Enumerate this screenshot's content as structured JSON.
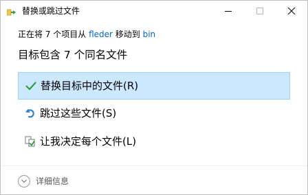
{
  "window": {
    "title": "替换或跳过文件",
    "controls": {
      "minimize": "minimize-icon",
      "maximize": "maximize-icon",
      "close": "close-icon"
    }
  },
  "move_info": {
    "prefix": "正在将 7 个项目从 ",
    "source": "fleder",
    "middle": " 移动到 ",
    "destination": "bin"
  },
  "heading": "目标包含 7 个同名文件",
  "options": {
    "replace": {
      "label": "替换目标中的文件(R)",
      "icon": "checkmark-icon",
      "selected": true
    },
    "skip": {
      "label": "跳过这些文件(S)",
      "icon": "skip-arrow-icon"
    },
    "decide": {
      "label": "让我决定每个文件(L)",
      "icon": "compare-files-icon"
    }
  },
  "details": {
    "label": "详细信息",
    "icon": "chevron-down-icon"
  },
  "colors": {
    "selected_background": "#cce8ff",
    "selected_border": "#99d1ff",
    "link": "#0066cc",
    "checkmark": "#2e9e3e",
    "skip_arrow": "#2c7cd4"
  }
}
